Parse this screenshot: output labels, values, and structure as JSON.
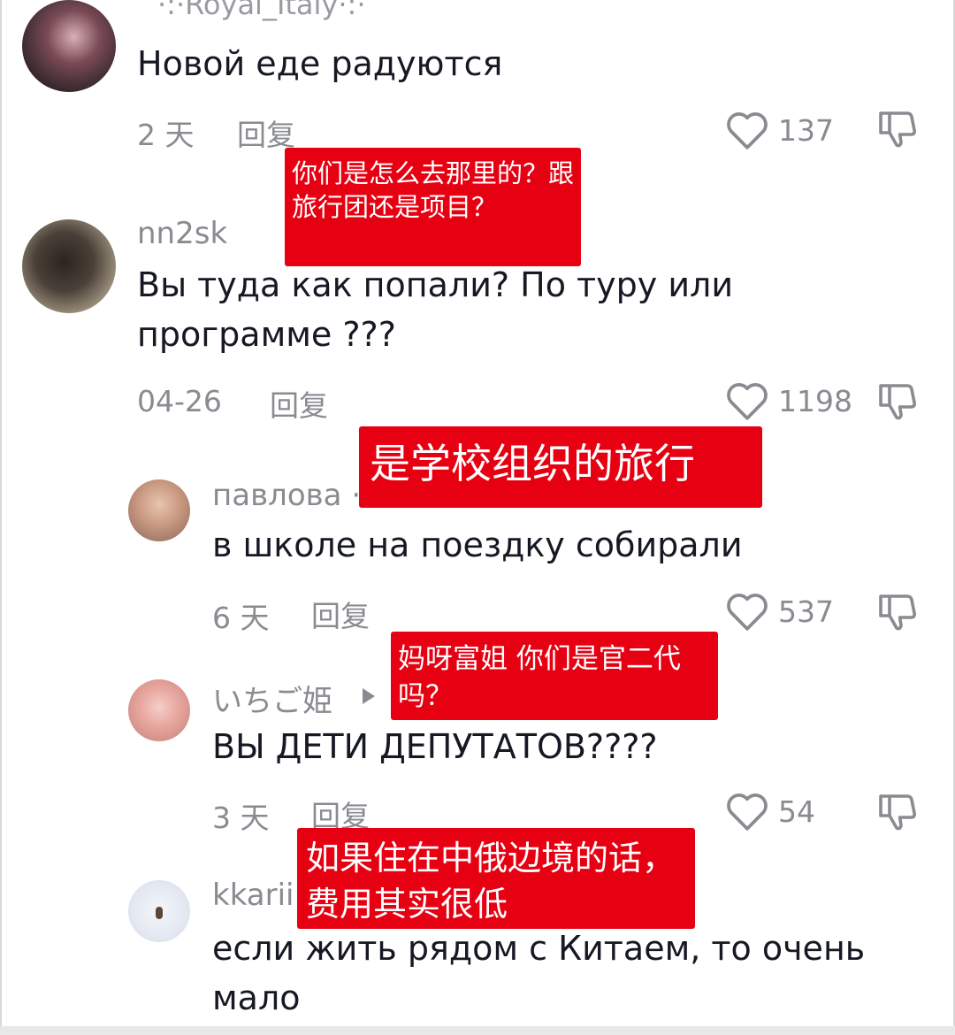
{
  "comments": [
    {
      "username": "·:·Royal_Italy·:·",
      "text": "Новой еде радуются",
      "time": "2 天",
      "reply": "回复",
      "likes": "137"
    },
    {
      "username": "nn2sk",
      "text": "Вы туда как попали? По туру или программе ???",
      "time": "04-26",
      "reply": "回复",
      "likes": "1198"
    },
    {
      "username": "павлова ·",
      "text": "в школе на поездку собирали",
      "time": "6 天",
      "reply": "回复",
      "likes": "537"
    },
    {
      "username": "いちご姫",
      "text": "ВЫ ДЕТИ ДЕПУТАТОВ????",
      "time": "3 天",
      "reply": "回复",
      "likes": "54"
    },
    {
      "username": "kkarii",
      "text": "если жить рядом с Китаем, то очень мало"
    }
  ],
  "notes": [
    "你们是怎么去那里的？跟旅行团还是项目？",
    "是学校组织的旅行",
    "妈呀富姐 你们是官二代吗？",
    "如果住在中俄边境的话，费用其实很低"
  ],
  "colors": {
    "note_bg": "#e60012",
    "meta_text": "#8a8b91",
    "body_text": "#161823"
  }
}
